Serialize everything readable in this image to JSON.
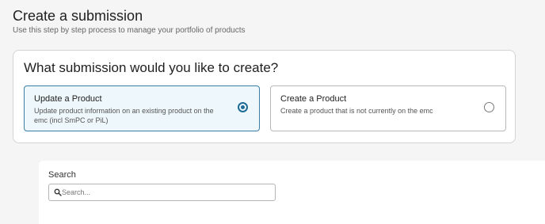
{
  "header": {
    "title": "Create a submission",
    "subtitle": "Use this step by step process to manage your portfolio of products"
  },
  "question": {
    "heading": "What submission would you like to create?",
    "options": [
      {
        "title": "Update a Product",
        "description": "Update product information on an existing product on the emc (incl SmPC or PiL)",
        "selected": true
      },
      {
        "title": "Create a Product",
        "description": "Create a product that is not currently on the emc",
        "selected": false
      }
    ]
  },
  "search": {
    "label": "Search",
    "placeholder": "Search...",
    "value": ""
  },
  "colors": {
    "accent": "#1e6b98",
    "selected_background": "#eef7fb",
    "page_background": "#f5f5f5"
  },
  "icons": {
    "search": "search-icon",
    "radio_checked": "radio-checked-icon",
    "radio_unchecked": "radio-unchecked-icon"
  }
}
